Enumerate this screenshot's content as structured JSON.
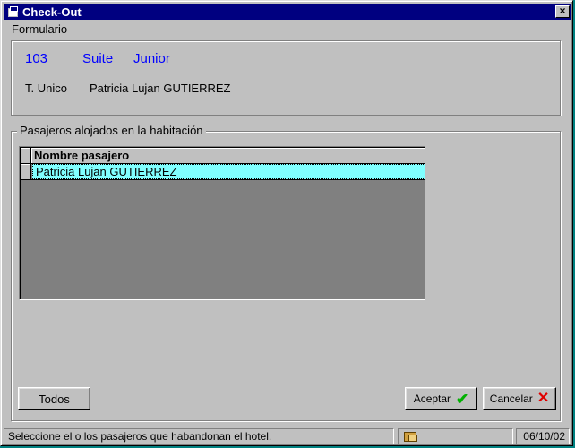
{
  "window": {
    "title": "Check-Out",
    "close_label": "×"
  },
  "menu": {
    "items": [
      {
        "label": "Formulario"
      }
    ]
  },
  "room": {
    "number": "103",
    "type": "Suite",
    "category": "Junior",
    "tarifa": "T. Unico",
    "holder": "Patricia Lujan  GUTIERREZ"
  },
  "guests": {
    "legend": "Pasajeros alojados en la habitación",
    "column_header": "Nombre pasajero",
    "rows": [
      {
        "name": "Patricia Lujan  GUTIERREZ"
      }
    ]
  },
  "buttons": {
    "todos": "Todos",
    "aceptar": "Aceptar",
    "cancelar": "Cancelar"
  },
  "status": {
    "message": "Seleccione el o los pasajeros que habandonan el hotel.",
    "date": "06/10/02"
  },
  "colors": {
    "title_bar": "#000080",
    "room_text": "#0000ff",
    "selected_row": "#80ffff",
    "face": "#c0c0c0"
  },
  "icons": {
    "aceptar": "check-icon",
    "cancelar": "cross-icon",
    "status": "folder-icon",
    "window": "app-icon"
  }
}
